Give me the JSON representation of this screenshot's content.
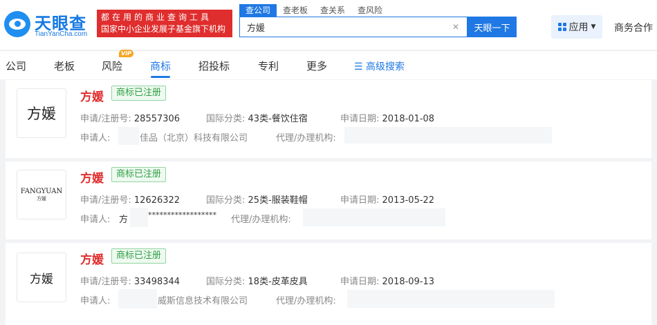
{
  "header": {
    "logo_text": "天眼查",
    "logo_sub": "TianYanCha.com",
    "banner_line1": "都在用的商业查询工具",
    "banner_line2": "国家中小企业发展子基金旗下机构",
    "search_tabs": [
      "查公司",
      "查老板",
      "查关系",
      "查风险"
    ],
    "search_value": "方媛",
    "search_button": "天眼一下",
    "apps_label": "应用",
    "business_label": "商务合作"
  },
  "nav": {
    "items": [
      "公司",
      "老板",
      "风险",
      "商标",
      "招投标",
      "专利",
      "更多"
    ],
    "vip_badge": "VIP",
    "advanced_search": "高级搜索"
  },
  "results": [
    {
      "name": "方媛",
      "status": "商标已注册",
      "image_text": "方媛",
      "reg_label": "申请/注册号:",
      "reg_no": "28557306",
      "class_label": "国际分类:",
      "class_value": "43类-餐饮住宿",
      "date_label": "申请日期:",
      "date": "2018-01-08",
      "applicant_label": "申请人:",
      "applicant": "佳品（北京）科技有限公司",
      "agent_label": "代理/办理机构:"
    },
    {
      "name": "方媛",
      "status": "商标已注册",
      "image_text": "FANGYUAN",
      "image_sub": "方媛",
      "reg_label": "申请/注册号:",
      "reg_no": "12626322",
      "class_label": "国际分类:",
      "class_value": "25类-服装鞋帽",
      "date_label": "申请日期:",
      "date": "2013-05-22",
      "applicant_label": "申请人:",
      "applicant": "方",
      "applicant_stars": "******************",
      "agent_label": "代理/办理机构:"
    },
    {
      "name": "方媛",
      "status": "商标已注册",
      "image_text": "方媛",
      "reg_label": "申请/注册号:",
      "reg_no": "33498344",
      "class_label": "国际分类:",
      "class_value": "18类-皮革皮具",
      "date_label": "申请日期:",
      "date": "2018-09-13",
      "applicant_label": "申请人:",
      "applicant": "威斯信息技术有限公司",
      "agent_label": "代理/办理机构:"
    }
  ]
}
